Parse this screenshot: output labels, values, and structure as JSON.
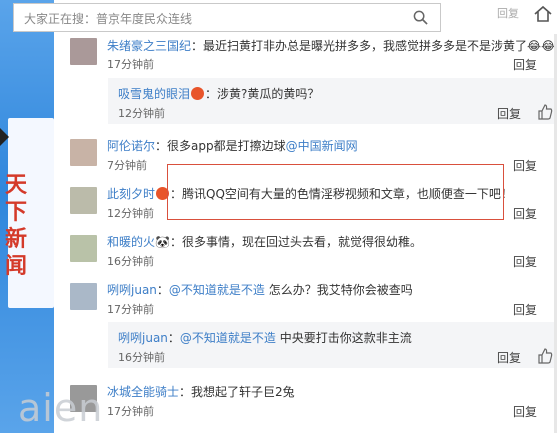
{
  "search": {
    "text": "大家正在搜：普京年度民众连线"
  },
  "top": {
    "label": "回复"
  },
  "slogan": [
    "天",
    "下",
    "新",
    "闻"
  ],
  "watermark": "aien",
  "comments": [
    {
      "nick": "朱绪豪之三国纪",
      "sep": "：",
      "text": "最近扫黄打非办总是曝光拼多多，我感觉拼多多是不是涉黄了",
      "time": "17分钟前",
      "reply": "回复"
    },
    {
      "nick": "吸雪鬼的眼泪",
      "sep": "：",
      "text": "涉黄?黄瓜的黄吗？",
      "time": "12分钟前",
      "reply": "回复",
      "nested": true
    },
    {
      "nick": "阿伦诺尔",
      "sep": "：",
      "text": "很多app都是打擦边球",
      "mention": "@中国新闻网",
      "time": "7分钟前",
      "reply": "回复"
    },
    {
      "nick": "此刻夕时",
      "sep": "：",
      "text": "腾讯QQ空间有大量的色情淫秽视频和文章，也顺便查一下吧！",
      "time": "12分钟前",
      "reply": "回复"
    },
    {
      "nick": "和暖的火",
      "sep": "：",
      "text": "很多事情，现在回过头去看，就觉得很幼稚。",
      "time": "16分钟前",
      "reply": "回复"
    },
    {
      "nick": "咧咧juan",
      "sep": "：",
      "mention": "@不知道就是不造",
      "text": " 怎么办？我艾特你会被查吗",
      "time": "17分钟前",
      "reply": "回复"
    },
    {
      "nick": "咧咧juan",
      "sep": "：",
      "mention": "@不知道就是不造",
      "text": " 中央要打击你这款非主流",
      "time": "16分钟前",
      "reply": "回复",
      "nested": true
    },
    {
      "nick": "冰城全能骑士",
      "sep": "：",
      "text": "我想起了轩子巨2兔",
      "time": "17分钟前",
      "reply": "回复"
    }
  ],
  "colors": {
    "link": "#3d7ec7",
    "highlight": "#d9503d",
    "strip": "#3a8ee0"
  }
}
